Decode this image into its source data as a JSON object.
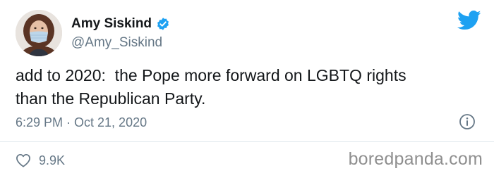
{
  "user": {
    "display_name": "Amy Siskind",
    "handle": "@Amy_Siskind",
    "avatar_icon": "avatar-photo-woman-with-mask",
    "verified_icon": "verified-badge-icon"
  },
  "tweet": {
    "text": "add to 2020:  the Pope more forward on LGBTQ rights\nthan the Republican Party.",
    "timestamp": "6:29 PM · Oct 21, 2020"
  },
  "stats": {
    "likes": "9.9K",
    "like_icon": "heart-icon"
  },
  "icons": {
    "brand": "twitter-bird-icon",
    "info": "info-icon"
  },
  "watermark": "boredpanda.com",
  "colors": {
    "twitter_blue": "#1da1f2",
    "text_primary": "#14171a",
    "text_secondary": "#657786",
    "divider": "#e1e8ed"
  }
}
